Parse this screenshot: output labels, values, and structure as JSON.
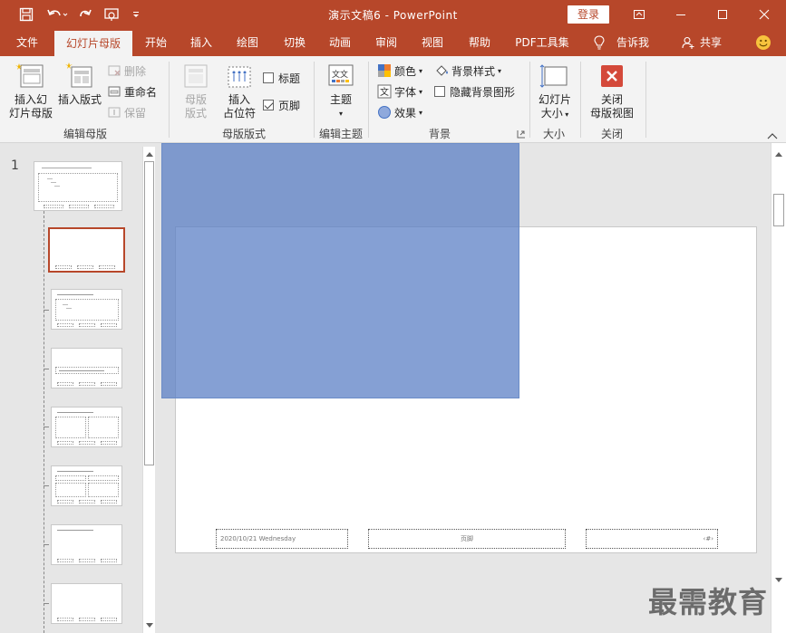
{
  "window": {
    "title": "演示文稿6 - PowerPoint",
    "login_label": "登录"
  },
  "tabs": [
    {
      "label": "文件"
    },
    {
      "label": "幻灯片母版"
    },
    {
      "label": "开始"
    },
    {
      "label": "插入"
    },
    {
      "label": "绘图"
    },
    {
      "label": "切换"
    },
    {
      "label": "动画"
    },
    {
      "label": "审阅"
    },
    {
      "label": "视图"
    },
    {
      "label": "帮助"
    },
    {
      "label": "PDF工具集"
    },
    {
      "label": "告诉我"
    },
    {
      "label": "共享"
    }
  ],
  "ribbon": {
    "edit_master": {
      "label": "编辑母版",
      "insert_slide_master_1": "插入幻",
      "insert_slide_master_2": "灯片母版",
      "insert_layout": "插入版式",
      "delete": "删除",
      "rename": "重命名",
      "preserve": "保留"
    },
    "master_layout": {
      "label": "母版版式",
      "master_layout_1": "母版",
      "master_layout_2": "版式",
      "insert_placeholder_1": "插入",
      "insert_placeholder_2": "占位符",
      "title_check": "标题",
      "footer_check": "页脚"
    },
    "edit_theme": {
      "label": "编辑主题",
      "theme": "主题"
    },
    "background": {
      "label": "背景",
      "colors": "颜色",
      "fonts": "字体",
      "effects": "效果",
      "bg_styles": "背景样式",
      "hide_bg": "隐藏背景图形"
    },
    "size": {
      "label": "大小",
      "slide_size_1": "幻灯片",
      "slide_size_2": "大小"
    },
    "close": {
      "label": "关闭",
      "close_master_1": "关闭",
      "close_master_2": "母版视图"
    }
  },
  "thumbnails": {
    "slide_number": "1"
  },
  "slide": {
    "date_text": "2020/10/21 Wednesday",
    "footer_text": "页脚",
    "page_number": "‹#›"
  },
  "watermark": "最需教育",
  "colors": {
    "accent": "#b7472a",
    "shape_fill": "#567cc4"
  }
}
